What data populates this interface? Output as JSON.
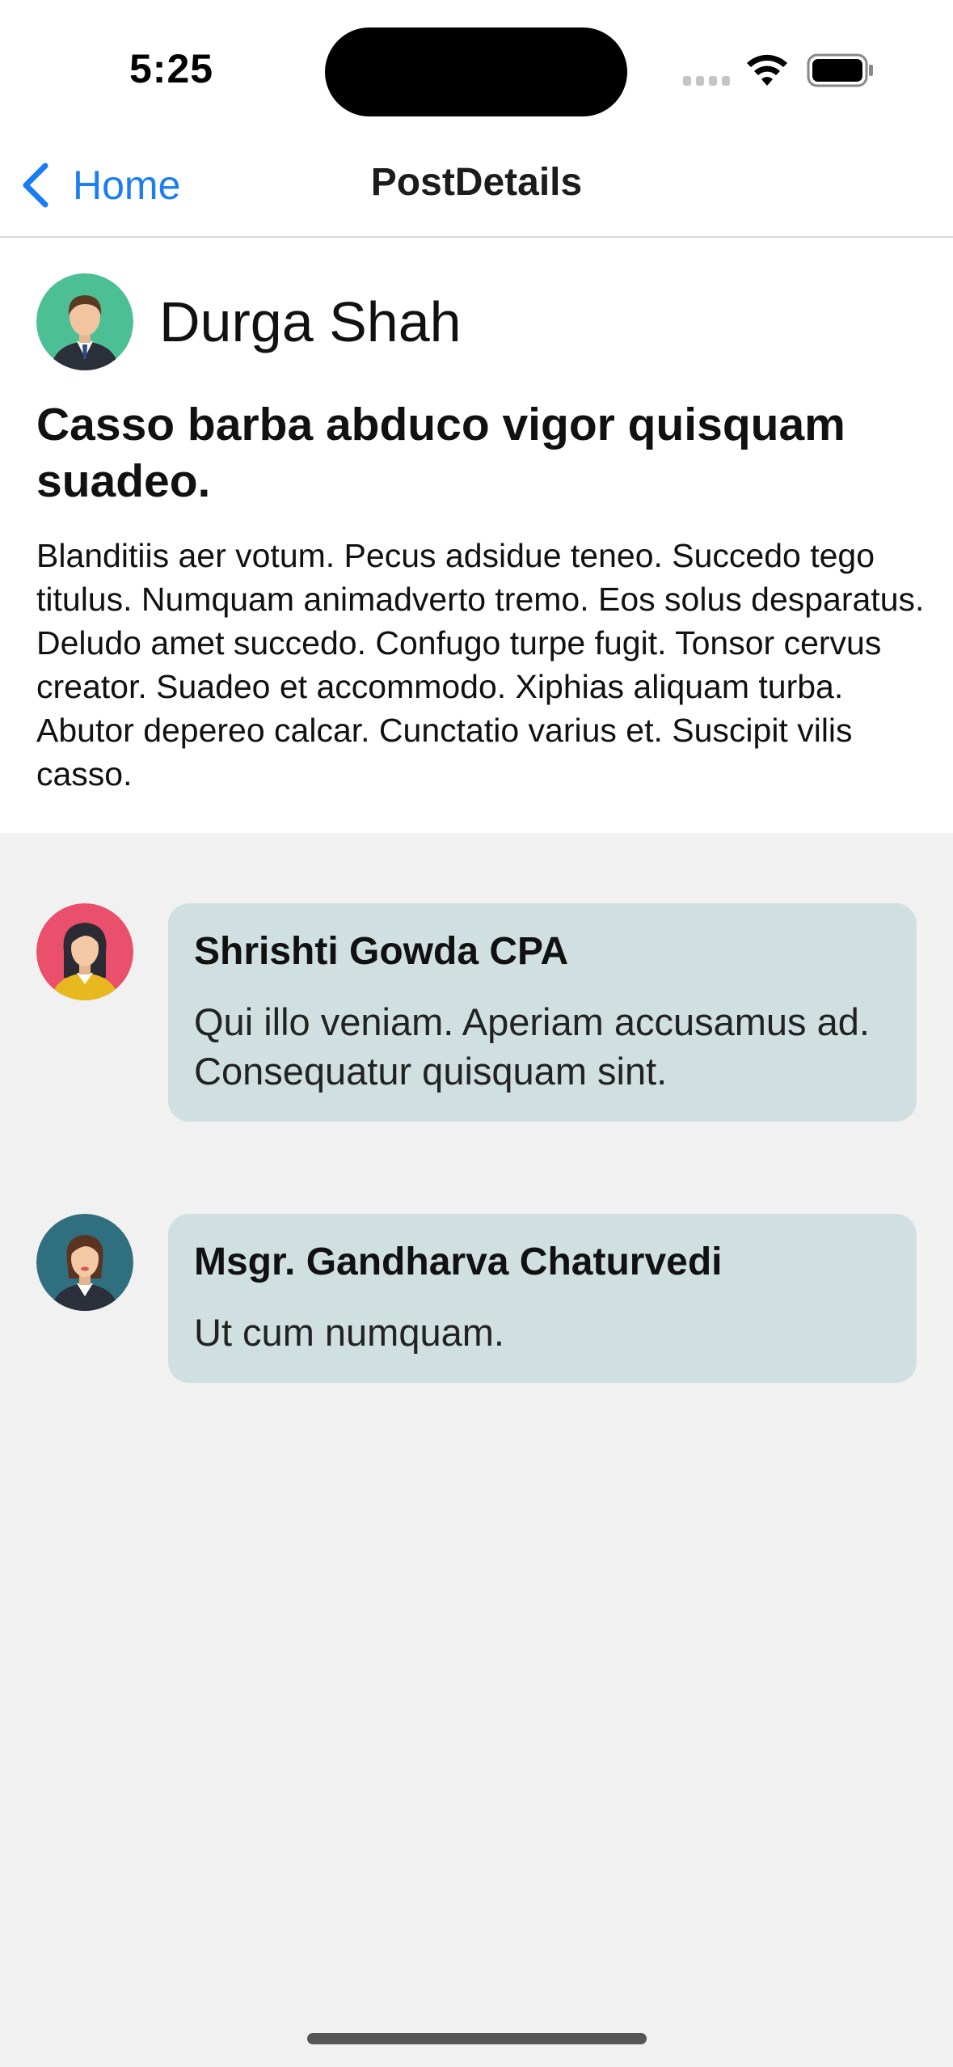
{
  "status_bar": {
    "time": "5:25",
    "icons": [
      "cellular-signal-icon",
      "wifi-icon",
      "battery-icon"
    ]
  },
  "nav": {
    "back_label": "Home",
    "title": "PostDetails",
    "accent_color": "#1a7df3"
  },
  "post": {
    "author": "Durga Shah",
    "avatar": "male-businessman-avatar",
    "title": "Casso barba abduco vigor quisquam suadeo.",
    "body": "Blanditiis aer votum. Pecus adsidue teneo. Succedo tego titulus. Numquam animadverto tremo. Eos solus desparatus. Deludo amet succedo. Confugo turpe fugit. Tonsor cervus creator. Suadeo et accommodo. Xiphias aliquam turba. Abutor depereo calcar. Cunctatio varius et. Suscipit vilis casso."
  },
  "comments": [
    {
      "author": "Shrishti Gowda CPA",
      "avatar": "female-avatar-pink",
      "text": "Qui illo veniam. Aperiam accusamus ad. Consequatur quisquam sint."
    },
    {
      "author": "Msgr. Gandharva Chaturvedi",
      "avatar": "female-avatar-teal",
      "text": "Ut cum numquam."
    }
  ],
  "colors": {
    "comment_bubble": "#d0e0e1",
    "background": "#f1f1f1"
  }
}
